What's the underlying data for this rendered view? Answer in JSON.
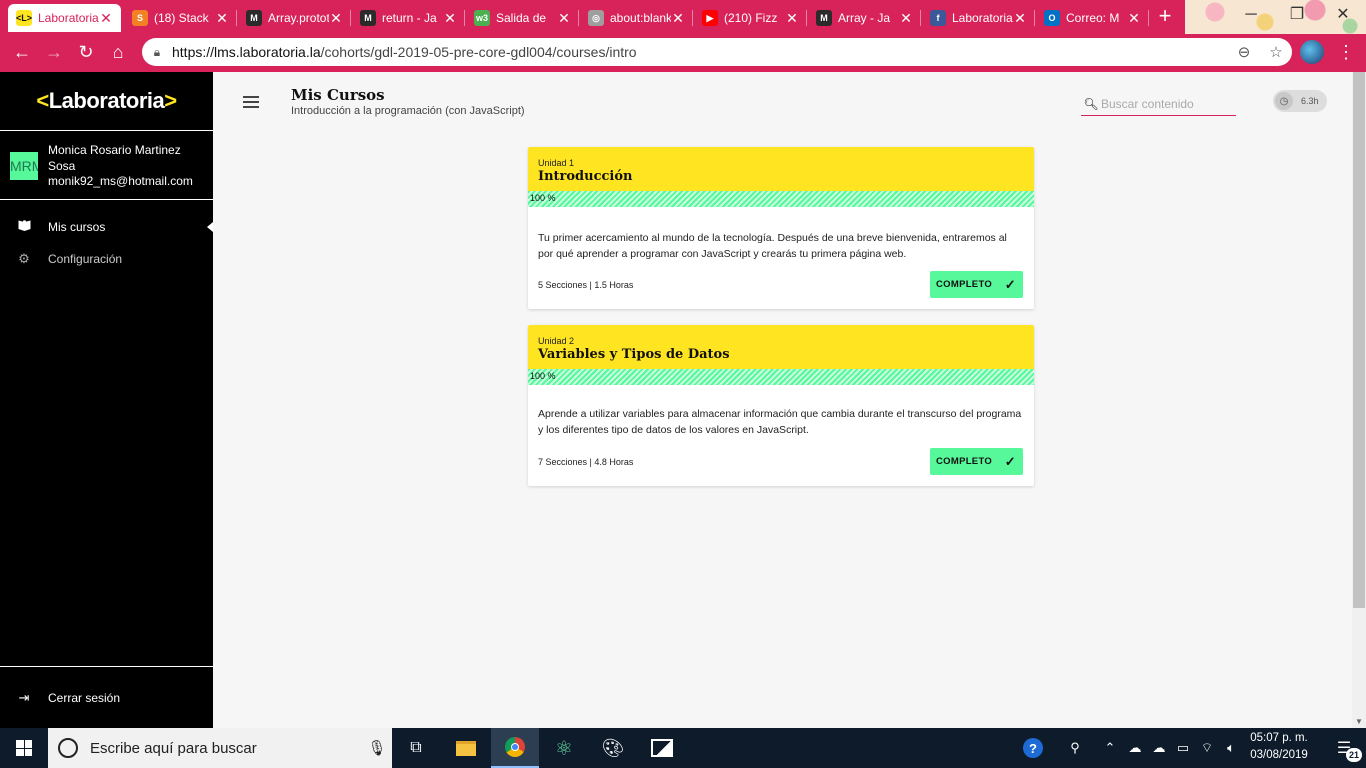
{
  "browser": {
    "tabs": [
      {
        "title": "Laboratoria",
        "favicon": "laboratoria-icon",
        "fav_color": "#ffe521",
        "fav_text": "<L>",
        "active": true
      },
      {
        "title": "(18) Stack",
        "favicon": "stackoverflow-icon",
        "fav_color": "#f48024",
        "fav_text": "S",
        "active": false
      },
      {
        "title": "Array.prototype",
        "favicon": "mdn-icon",
        "fav_color": "#2b2b2b",
        "fav_text": "M",
        "active": false
      },
      {
        "title": "return - Ja",
        "favicon": "mdn-icon",
        "fav_color": "#2b2b2b",
        "fav_text": "M",
        "active": false
      },
      {
        "title": "Salida de",
        "favicon": "w3schools-icon",
        "fav_color": "#4caf50",
        "fav_text": "w3",
        "active": false
      },
      {
        "title": "about:blank",
        "favicon": "globe-icon",
        "fav_color": "#9e9e9e",
        "fav_text": "◎",
        "active": false
      },
      {
        "title": "(210) Fizz",
        "favicon": "youtube-icon",
        "fav_color": "#ff0000",
        "fav_text": "▶",
        "active": false
      },
      {
        "title": "Array - Ja",
        "favicon": "mdn-icon",
        "fav_color": "#2b2b2b",
        "fav_text": "M",
        "active": false
      },
      {
        "title": "Laboratoria",
        "favicon": "facebook-icon",
        "fav_color": "#3b5998",
        "fav_text": "f",
        "active": false
      },
      {
        "title": "Correo: M",
        "favicon": "outlook-icon",
        "fav_color": "#0072c6",
        "fav_text": "O",
        "active": false
      }
    ],
    "url_host": "https://lms.laboratoria.la",
    "url_path": "/cohorts/gdl-2019-05-pre-core-gdl004/courses/intro"
  },
  "sidebar": {
    "logo_left": "<",
    "logo_text": "Laboratoria",
    "logo_right": ">",
    "avatar_initials": "MRM",
    "user_name": "Monica Rosario Martinez Sosa",
    "user_email": "monik92_ms@hotmail.com",
    "items": [
      {
        "label": "Mis cursos",
        "icon": "book-icon"
      },
      {
        "label": "Configuración",
        "icon": "gear-icon"
      }
    ],
    "logout_label": "Cerrar sesión"
  },
  "main": {
    "title": "Mis Cursos",
    "subtitle": "Introducción a la programación (con JavaScript)",
    "search_placeholder": "Buscar contenido",
    "time_label": "6.3h",
    "units": [
      {
        "unit_label": "Unidad 1",
        "title": "Introducción",
        "progress_label": "100 %",
        "progress": 1.0,
        "description": "Tu primer acercamiento al mundo de la tecnología. Después de una breve bienvenida, entraremos al por qué aprender a programar con JavaScript y crearás tu primera página web.",
        "meta": "5 Secciones | 1.5 Horas",
        "status": "COMPLETO"
      },
      {
        "unit_label": "Unidad 2",
        "title": "Variables y Tipos de Datos",
        "progress_label": "100 %",
        "progress": 1.0,
        "description": "Aprende a utilizar variables para almacenar información que cambia durante el transcurso del programa y los diferentes tipo de datos de los valores en JavaScript.",
        "meta": "7 Secciones | 4.8 Horas",
        "status": "COMPLETO"
      }
    ]
  },
  "taskbar": {
    "search_text": "Escribe aquí para buscar",
    "time": "05:07 p. m.",
    "date": "03/08/2019",
    "notification_count": "21"
  },
  "colors": {
    "brand_pink": "#d8225a",
    "brand_yellow": "#ffe521",
    "success_green": "#56f89a"
  }
}
